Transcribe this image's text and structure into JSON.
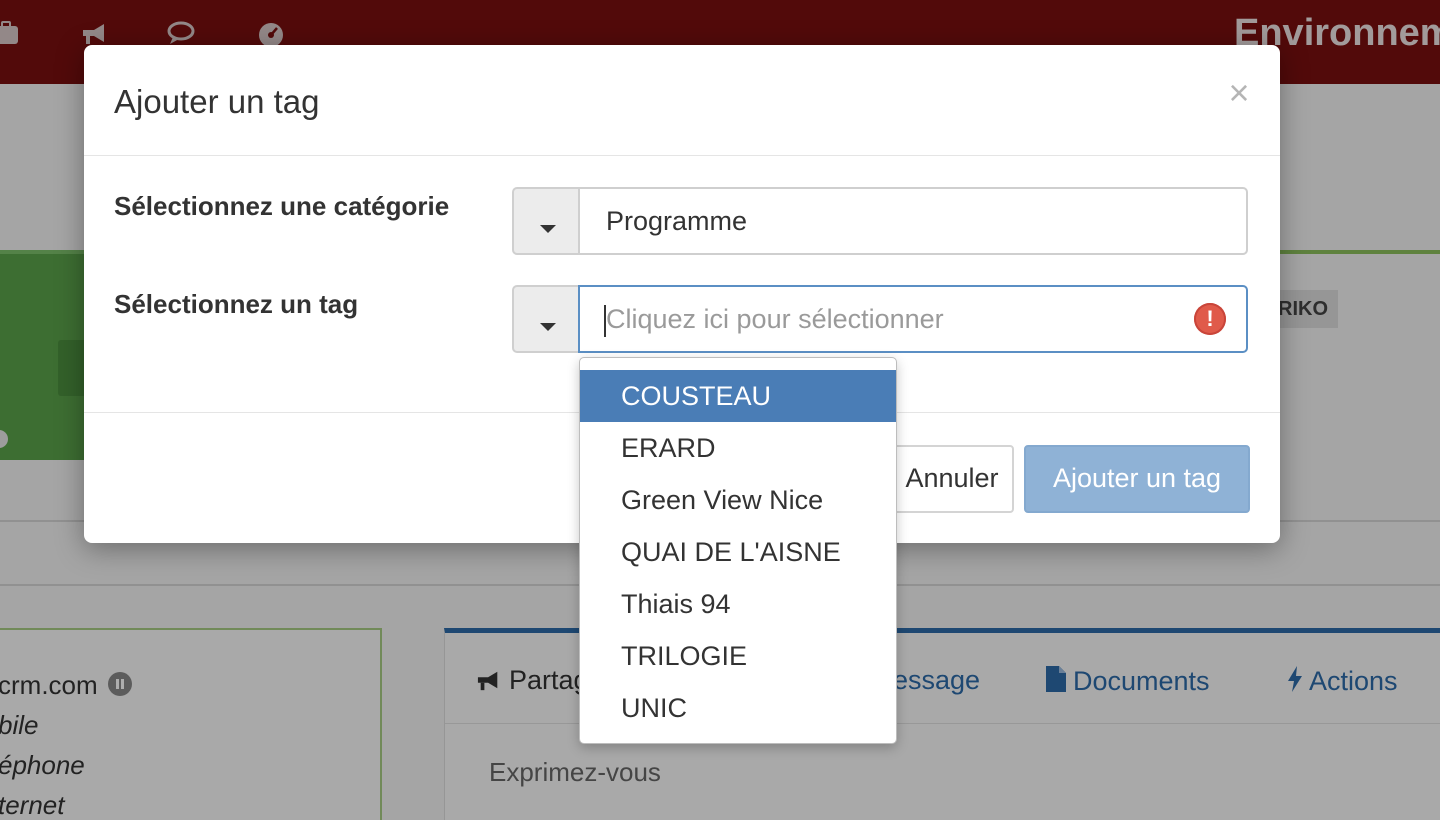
{
  "background": {
    "header": {
      "title": "Environnem",
      "icons": [
        "briefcase-icon",
        "megaphone-icon",
        "chat-icon",
        "dashboard-icon"
      ]
    },
    "tag_chip": "RIKO",
    "contact": {
      "email_partial": "crm.com",
      "mobile_partial": "bile",
      "phone_partial": "éphone",
      "internet_partial": "ternet"
    },
    "feed": {
      "tabs": [
        {
          "label": "Partag",
          "icon": "megaphone-icon"
        },
        {
          "label": "essage",
          "icon": "message-icon"
        },
        {
          "label": "Documents",
          "icon": "document-icon"
        },
        {
          "label": "Actions",
          "icon": "bolt-icon"
        }
      ],
      "input_placeholder": "Exprimez-vous"
    }
  },
  "modal": {
    "title": "Ajouter un tag",
    "close_symbol": "×",
    "category": {
      "label": "Sélectionnez une catégorie",
      "value": "Programme"
    },
    "tag": {
      "label": "Sélectionnez un tag",
      "placeholder": "Cliquez ici pour sélectionner",
      "error_symbol": "!"
    },
    "buttons": {
      "cancel": "Annuler",
      "submit": "Ajouter un tag"
    }
  },
  "dropdown": {
    "options": [
      "COUSTEAU",
      "ERARD",
      "Green View Nice",
      "QUAI DE L'AISNE",
      "Thiais 94",
      "TRILOGIE",
      "UNIC"
    ],
    "highlighted": "COUSTEAU"
  },
  "colors": {
    "header_bg": "#7a1010",
    "primary_blue": "#4a7db6",
    "disabled_button": "#8fb2d6",
    "error": "#e05a4a",
    "green_card": "#5aa34a"
  }
}
